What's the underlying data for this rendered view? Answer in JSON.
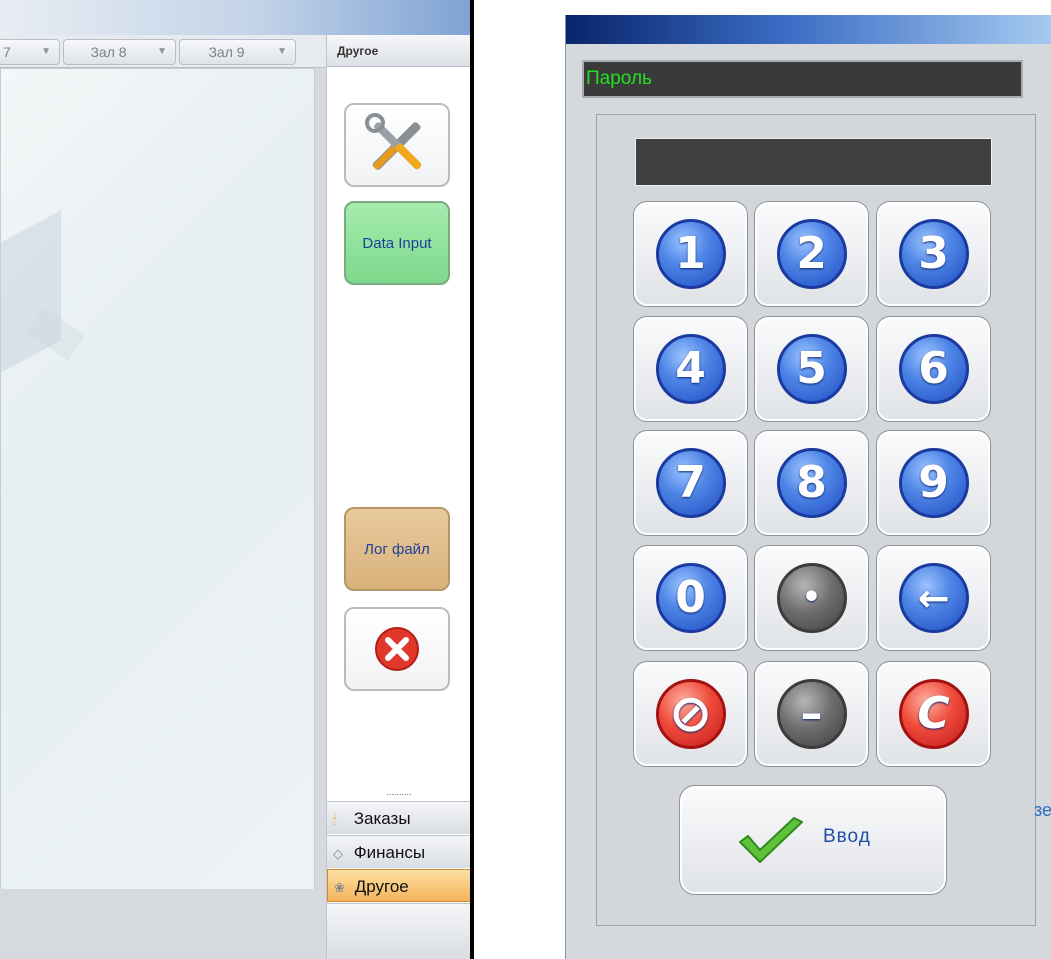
{
  "left_app": {
    "hall_tabs": [
      {
        "label": "7"
      },
      {
        "label": "Зал 8"
      },
      {
        "label": "Зал 9"
      }
    ],
    "side_panel": {
      "header": "Другое",
      "buttons": {
        "tools_icon": "tools-icon",
        "data_input": "Data Input",
        "log_file": "Лог файл",
        "close_icon": "close-icon"
      },
      "divider_dots": "..........",
      "nav": [
        {
          "label": "Заказы",
          "icon": "orders-icon"
        },
        {
          "label": "Финансы",
          "icon": "finance-icon"
        },
        {
          "label": "Другое",
          "icon": "other-icon",
          "active": true
        }
      ]
    }
  },
  "password_dialog": {
    "title_label": "Пароль",
    "password_value": "",
    "keys": [
      {
        "label": "1"
      },
      {
        "label": "2"
      },
      {
        "label": "3"
      },
      {
        "label": "4"
      },
      {
        "label": "5"
      },
      {
        "label": "6"
      },
      {
        "label": "7"
      },
      {
        "label": "8"
      },
      {
        "label": "9"
      },
      {
        "label": "0"
      },
      {
        "label": "•"
      },
      {
        "label": "←"
      },
      {
        "label": "⊘"
      },
      {
        "label": "–"
      },
      {
        "label": "C"
      }
    ],
    "enter_label": "Ввод",
    "cut_text": "зе"
  },
  "colors": {
    "active_tab": "#f4b45a",
    "key_blue": "#1f4cc4",
    "key_red": "#c21b1b",
    "key_gray": "#3f3f3f",
    "password_label_green": "#22e022",
    "title_bar_dark": "#0a246a"
  }
}
